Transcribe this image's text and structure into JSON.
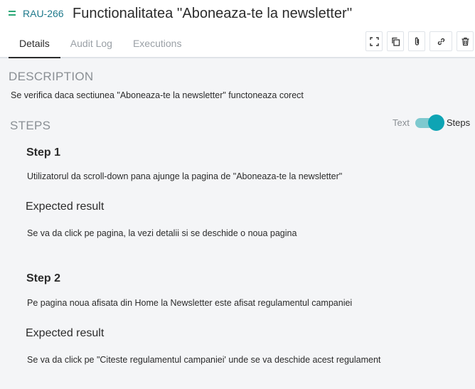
{
  "issue": {
    "key": "RAU-266",
    "title": "Functionalitatea ''Aboneaza-te la newsletter''"
  },
  "tabs": [
    {
      "label": "Details",
      "active": true
    },
    {
      "label": "Audit Log",
      "active": false
    },
    {
      "label": "Executions",
      "active": false
    }
  ],
  "toolbar": {
    "icons": [
      "expand-icon",
      "copy-icon",
      "attach-icon",
      "link-icon",
      "delete-icon"
    ]
  },
  "description": {
    "heading": "DESCRIPTION",
    "text": "Se verifica daca sectiunea \"Aboneaza-te la newsletter\" functoneaza corect"
  },
  "steps": {
    "heading": "STEPS",
    "toggle": {
      "left_label": "Text",
      "right_label": "Steps",
      "selected": "Steps"
    },
    "expected_label": "Expected result",
    "items": [
      {
        "title": "Step 1",
        "action": "Utilizatorul da scroll-down pana ajunge la pagina de \"Aboneaza-te la newsletter\"",
        "expected": "Se va da click pe pagina, la vezi detalii si se deschide o noua pagina"
      },
      {
        "title": "Step 2",
        "action": "Pe pagina noua afisata din Home la Newsletter este afisat regulamentul campaniei",
        "expected": "Se va da click pe \"Citeste regulamentul campaniei' unde se va deschide acest regulament"
      }
    ]
  },
  "colors": {
    "accent": "#0ea4b4",
    "key": "#1f7a8c",
    "priority": "#2aa876"
  }
}
